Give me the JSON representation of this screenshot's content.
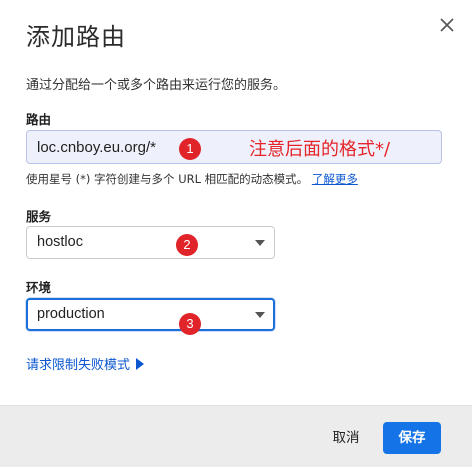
{
  "dialog": {
    "title": "添加路由",
    "close_icon": "close-icon",
    "description": "通过分配给一个或多个路由来运行您的服务。"
  },
  "route": {
    "label": "路由",
    "value": "loc.cnboy.eu.org/*",
    "annotation": "注意后面的格式*/",
    "hint": "使用星号 (*) 字符创建与多个 URL 相匹配的动态模式。",
    "learn_more": "了解更多"
  },
  "service": {
    "label": "服务",
    "selected": "hostloc"
  },
  "environment": {
    "label": "环境",
    "selected": "production"
  },
  "badges": [
    "1",
    "2",
    "3"
  ],
  "limit_link": "请求限制失败模式",
  "footer": {
    "cancel": "取消",
    "save": "保存"
  },
  "colors": {
    "accent": "#1473e6",
    "annotation_red": "#e5252a",
    "link": "#0b57d0"
  }
}
